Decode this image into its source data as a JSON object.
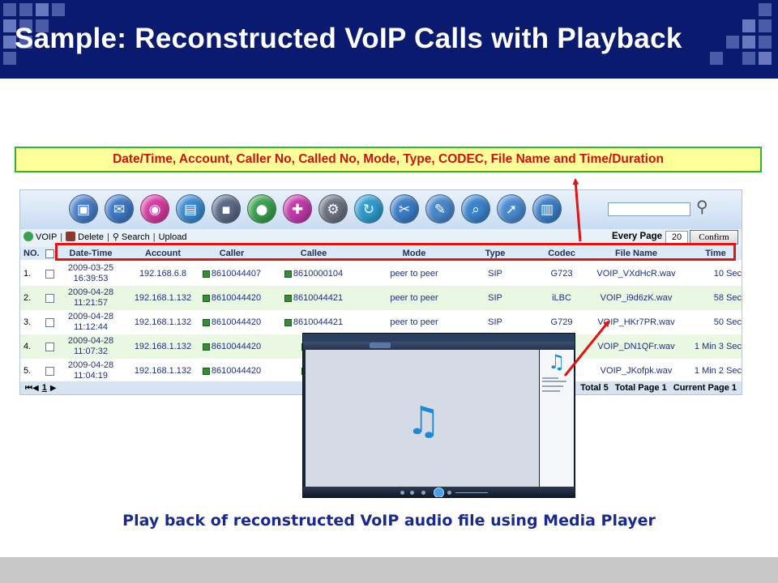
{
  "slide": {
    "title": "Sample: Reconstructed VoIP Calls with Playback",
    "callout": "Date/Time, Account, Caller No, Called No, Mode, Type, CODEC, File Name and Time/Duration",
    "caption": "Play back of reconstructed VoIP audio file using Media Player",
    "colors": {
      "header_bg": "#0a1a6e",
      "callout_text": "#cc1111",
      "callout_bg": "#ffff99",
      "callout_border": "#2fb52f",
      "highlight": "#e01414",
      "caption": "#1a2a8a"
    }
  },
  "app": {
    "toolbar": {
      "voip_label": "VOIP",
      "delete_label": "Delete",
      "search_label": "Search",
      "upload_label": "Upload",
      "separator": "|",
      "every_page_label": "Every Page",
      "every_page_value": "20",
      "confirm_label": "Confirm"
    },
    "icons": [
      "server-icon",
      "mail-icon",
      "lips-chat-icon",
      "folder-window-icon",
      "terminal-icon",
      "globe-icon",
      "network-icon",
      "gear-icon",
      "refresh-icon",
      "tools-icon",
      "notes-icon",
      "magnifier-icon",
      "share-icon",
      "bar-chart-icon"
    ],
    "columns": [
      "NO.",
      "Date-Time",
      "Account",
      "Caller",
      "Callee",
      "Mode",
      "Type",
      "Codec",
      "File Name",
      "Time"
    ],
    "rows": [
      {
        "no": "1.",
        "date": "2009-03-25",
        "time": "16:39:53",
        "account": "192.168.6.8",
        "caller": "8610044407",
        "callee": "8610000104",
        "mode": "peer to peer",
        "type": "SIP",
        "codec": "G723",
        "file": "VOIP_VXdHcR.wav",
        "duration": "10 Sec"
      },
      {
        "no": "2.",
        "date": "2009-04-28",
        "time": "11:21:57",
        "account": "192.168.1.132",
        "caller": "8610044420",
        "callee": "8610044421",
        "mode": "peer to peer",
        "type": "SIP",
        "codec": "iLBC",
        "file": "VOIP_i9d6zK.wav",
        "duration": "58 Sec"
      },
      {
        "no": "3.",
        "date": "2009-04-28",
        "time": "11:12:44",
        "account": "192.168.1.132",
        "caller": "8610044420",
        "callee": "8610044421",
        "mode": "peer to peer",
        "type": "SIP",
        "codec": "G729",
        "file": "VOIP_HKr7PR.wav",
        "duration": "50 Sec"
      },
      {
        "no": "4.",
        "date": "2009-04-28",
        "time": "11:07:32",
        "account": "192.168.1.132",
        "caller": "8610044420",
        "callee": "861",
        "mode": "",
        "type": "",
        "codec": "",
        "file": "VOIP_DN1QFr.wav",
        "duration": "1 Min 3 Sec"
      },
      {
        "no": "5.",
        "date": "2009-04-28",
        "time": "11:04:19",
        "account": "192.168.1.132",
        "caller": "8610044420",
        "callee": "861",
        "mode": "",
        "type": "",
        "codec": "",
        "file": "VOIP_JKofpk.wav",
        "duration": "1 Min 2 Sec"
      }
    ],
    "pager": {
      "nav_first": "⏮",
      "nav_prev": "◀",
      "page": "1",
      "nav_next": "▶",
      "total": "Total 5",
      "total_page": "Total Page 1",
      "current_page": "Current Page 1"
    }
  },
  "player": {
    "icon": "music-note-icon",
    "note_glyph": "♫"
  }
}
